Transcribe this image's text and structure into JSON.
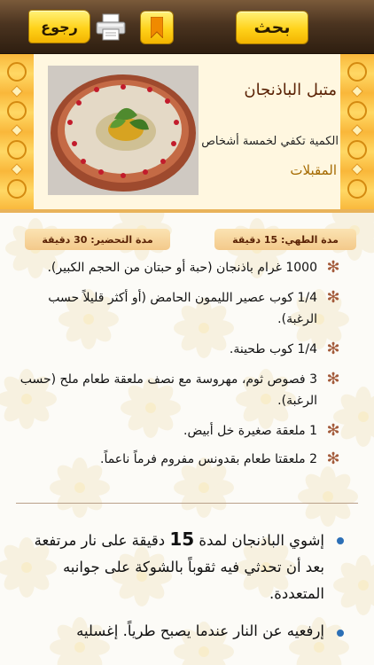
{
  "toolbar": {
    "search_label": "بحث",
    "back_label": "رجوع"
  },
  "recipe": {
    "title": "متبل الباذنجان",
    "servings": "الكمية تكفي لخمسة أشخاص",
    "category": "المقبلات",
    "cook_time": "مدة الطهي: 15 دقيقة",
    "prep_time": "مدة التحضير: 30 دقيقة"
  },
  "ingredients": [
    "1000 غرام باذنجان (حبة أو حبتان من الحجم الكبير).",
    "1/4 كوب عصير الليمون الحامض (أو أكثر قليلاً حسب الرغبة).",
    "1/4 كوب طحينة.",
    "3 فصوص ثوم، مهروسة مع نصف ملعقة طعام ملح (حسب الرغبة).",
    "1 ملعقة صغيرة خل أبيض.",
    "2 ملعقتا طعام بقدونس مفروم فرماً ناعماً."
  ],
  "steps": {
    "step1_before": "إشوي الباذنجان لمدة ",
    "step1_number": "15",
    "step1_after": " دقيقة على نار مرتفعة بعد أن تحدثي فيه ثقوباً بالشوكة على جوانبه المتعددة.",
    "step2": "إرفعيه عن النار عندما يصبح طرياً. إغسليه"
  },
  "colors": {
    "topbar": "#4b3420",
    "gold_button": "#ffd21a",
    "title_brown": "#5a2205",
    "category_gold": "#a56a00",
    "bullet_blue": "#2c6fb6",
    "star": "#a35a3a"
  },
  "icons": [
    "print-icon",
    "bookmark-icon",
    "back-arrow-icon",
    "star-bullet-icon"
  ]
}
